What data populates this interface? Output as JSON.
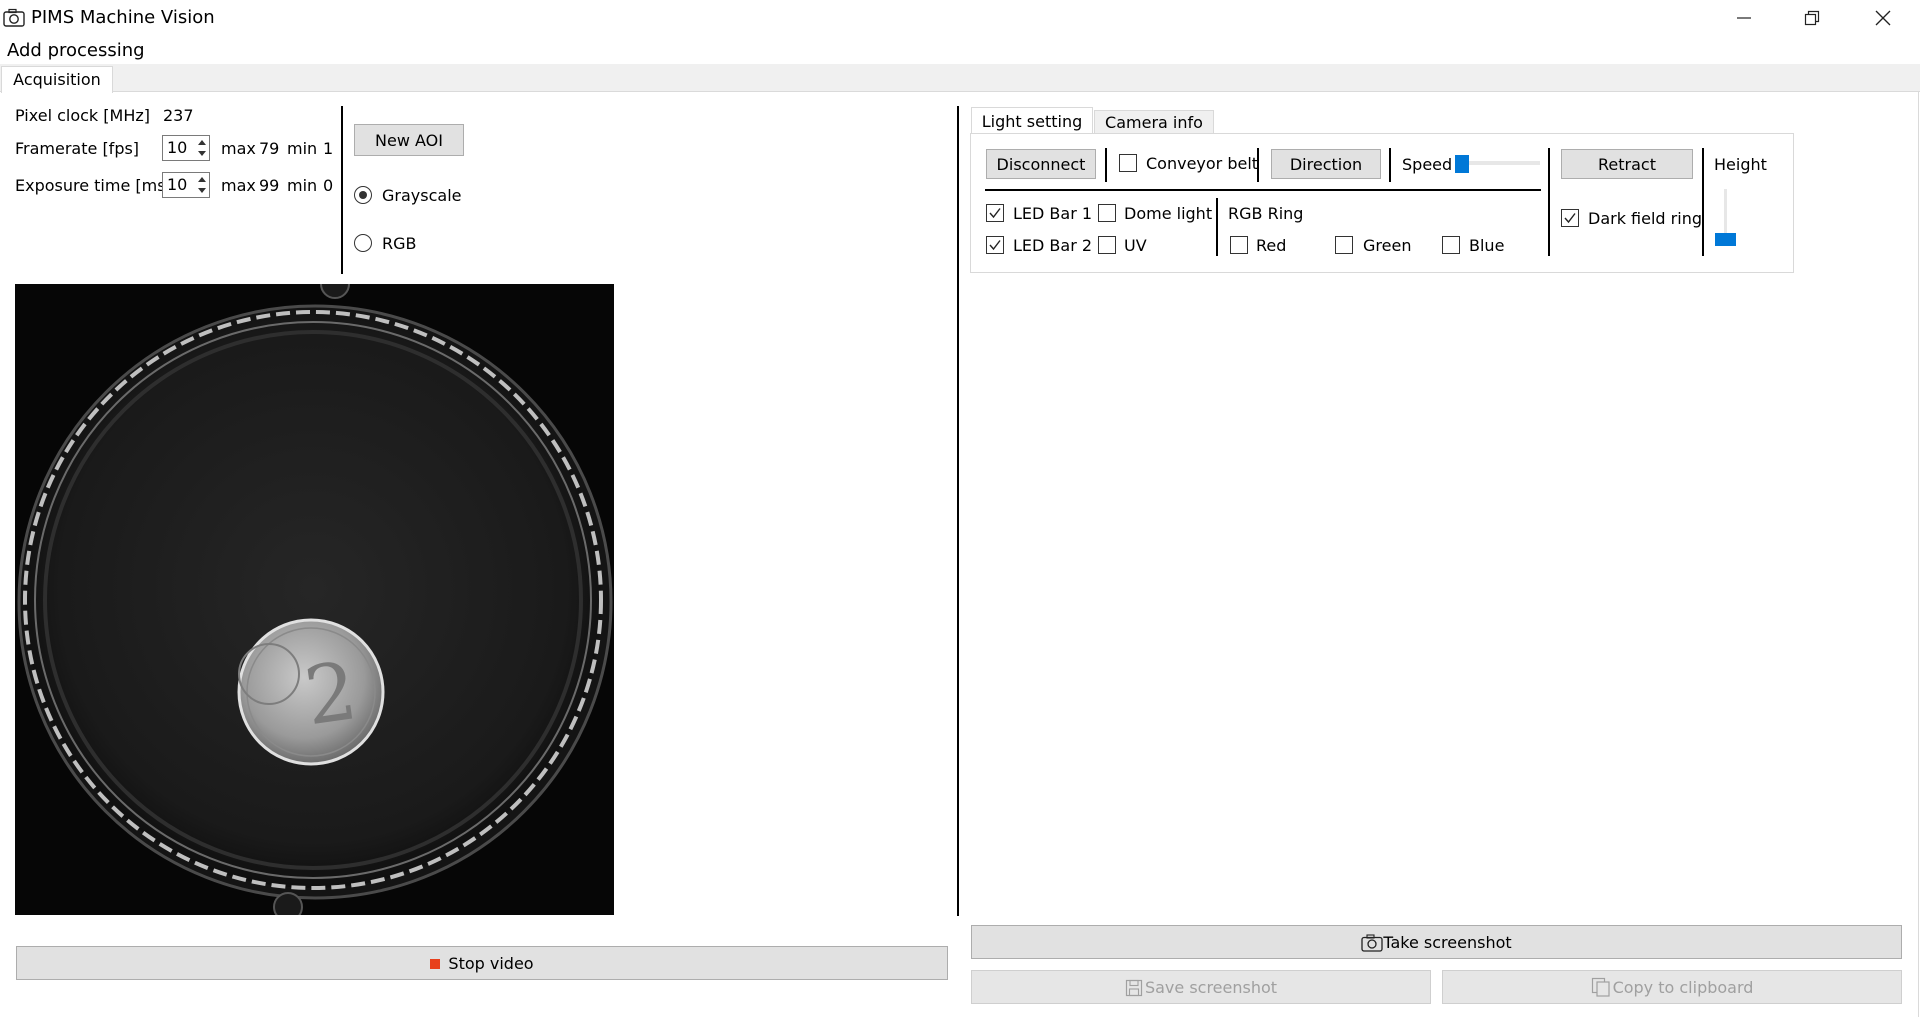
{
  "window": {
    "title": "PIMS Machine Vision",
    "icons": {
      "app": "camera-icon",
      "minimize": "minimize-icon",
      "restore": "restore-icon",
      "close": "close-icon"
    }
  },
  "menu": {
    "add_processing": "Add processing"
  },
  "tabs": {
    "acquisition": "Acquisition"
  },
  "acquisition": {
    "pixel_clock_label": "Pixel clock [MHz]",
    "pixel_clock_value": "237",
    "framerate_label": "Framerate [fps]",
    "framerate_value": "10",
    "framerate_max_label": "max",
    "framerate_max": "79",
    "framerate_min_label": "min",
    "framerate_min": "1",
    "exposure_label": "Exposure time [ms]",
    "exposure_value": "10",
    "exposure_max_label": "max",
    "exposure_max": "99",
    "exposure_min_label": "min",
    "exposure_min": "0",
    "new_aoi": "New AOI",
    "color_mode": {
      "grayscale": "Grayscale",
      "rgb": "RGB",
      "selected": "Grayscale"
    },
    "stop_video": "Stop video"
  },
  "right_tabs": {
    "light_setting": "Light setting",
    "camera_info": "Camera info",
    "active": "Light setting"
  },
  "light": {
    "disconnect": "Disconnect",
    "conveyor_belt": "Conveyor belt",
    "conveyor_belt_checked": false,
    "direction": "Direction",
    "speed_label": "Speed",
    "speed_value": 0,
    "retract": "Retract",
    "height_label": "Height",
    "height_value": 0,
    "led_bar_1": "LED Bar 1",
    "led_bar_1_checked": true,
    "led_bar_2": "LED Bar 2",
    "led_bar_2_checked": true,
    "dome_light": "Dome light",
    "dome_light_checked": false,
    "uv": "UV",
    "uv_checked": false,
    "rgb_ring_label": "RGB Ring",
    "red": "Red",
    "red_checked": false,
    "green": "Green",
    "green_checked": false,
    "blue": "Blue",
    "blue_checked": false,
    "dark_field_ring": "Dark field ring",
    "dark_field_ring_checked": true
  },
  "screenshot": {
    "take": "Take screenshot",
    "save": "Save screenshot",
    "copy": "Copy to clipboard"
  },
  "colors": {
    "accent": "#0078d7",
    "stop_icon": "#e8401c",
    "button_bg": "#e1e1e1",
    "disabled_text": "#a0a0a0"
  }
}
